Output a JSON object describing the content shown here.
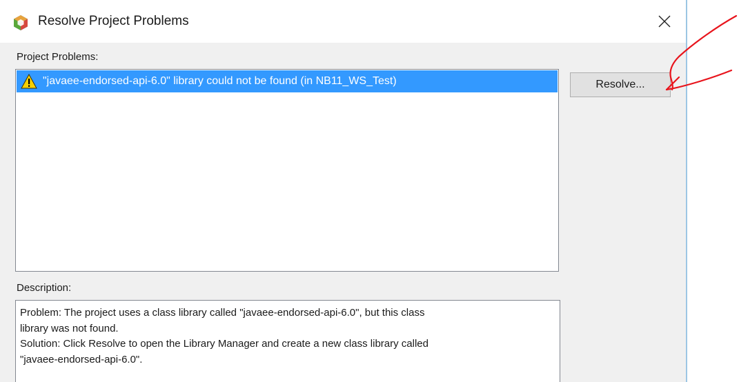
{
  "window": {
    "title": "Resolve Project Problems",
    "close_icon": "close-icon",
    "app_icon": "netbeans-logo-icon"
  },
  "problems": {
    "label": "Project Problems:",
    "items": [
      {
        "icon": "warning-icon",
        "text": "\"javaee-endorsed-api-6.0\" library could not be found (in NB11_WS_Test)",
        "selected": true
      }
    ]
  },
  "actions": {
    "resolve_label": "Resolve..."
  },
  "description": {
    "label": "Description:",
    "lines": [
      "Problem: The project uses a class library called \"javaee-endorsed-api-6.0\", but this class",
      "library was not found.",
      "Solution: Click Resolve to open the Library Manager and create a new class library called",
      "\"javaee-endorsed-api-6.0\"."
    ]
  },
  "colors": {
    "selection": "#3399ff",
    "annotation": "#e8141c",
    "dialog_bg": "#f0f0f0"
  }
}
